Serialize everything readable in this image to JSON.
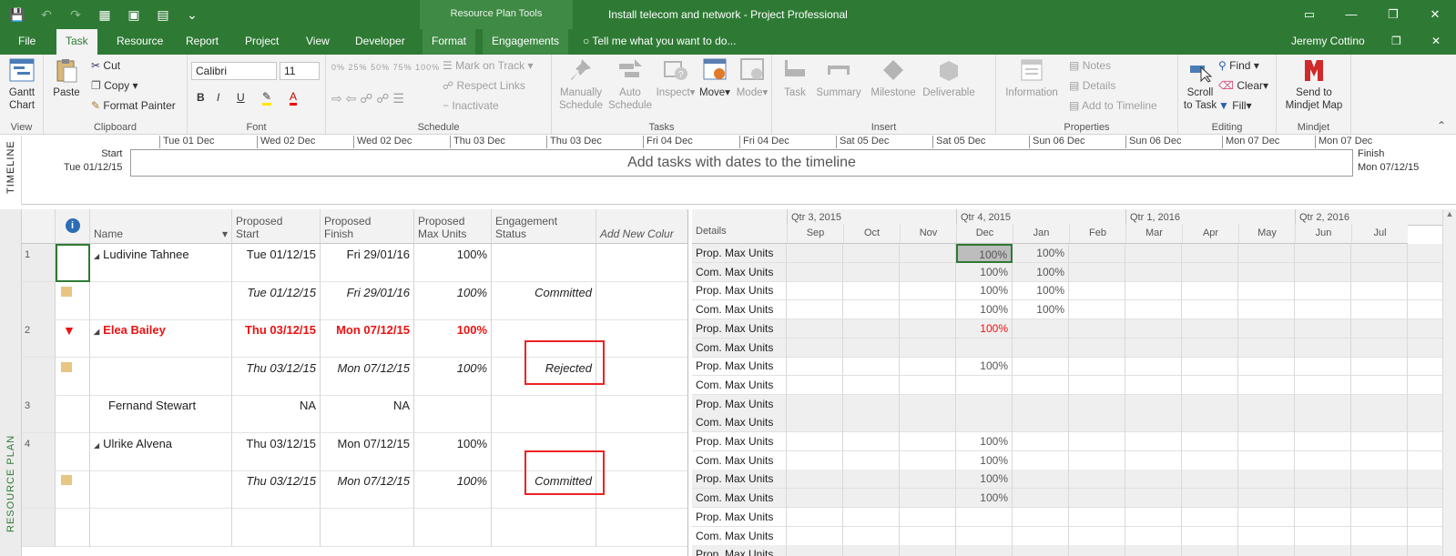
{
  "window": {
    "title": "Install telecom and network - Project Professional",
    "contextual_tab_group": "Resource Plan Tools",
    "user": "Jeremy Cottino"
  },
  "tabs": [
    {
      "label": "File"
    },
    {
      "label": "Task"
    },
    {
      "label": "Resource"
    },
    {
      "label": "Report"
    },
    {
      "label": "Project"
    },
    {
      "label": "View"
    },
    {
      "label": "Developer"
    },
    {
      "label": "Format"
    },
    {
      "label": "Engagements"
    }
  ],
  "tell_me": "Tell me what you want to do...",
  "ribbon": {
    "view": {
      "label": "View",
      "gantt": "Gantt\nChart"
    },
    "clipboard": {
      "label": "Clipboard",
      "paste": "Paste",
      "cut": "Cut",
      "copy": "Copy",
      "format_painter": "Format Painter"
    },
    "font": {
      "label": "Font",
      "family": "Calibri",
      "size": "11",
      "bold": "B",
      "italic": "I",
      "underline": "U"
    },
    "schedule": {
      "label": "Schedule",
      "mark_on_track": "Mark on Track",
      "respect_links": "Respect Links",
      "inactivate": "Inactivate",
      "pct": [
        "0%",
        "25%",
        "50%",
        "75%",
        "100%"
      ]
    },
    "tasks": {
      "label": "Tasks",
      "manually": "Manually\nSchedule",
      "auto": "Auto\nSchedule",
      "inspect": "Inspect",
      "move": "Move",
      "mode": "Mode"
    },
    "insert": {
      "label": "Insert",
      "task": "Task",
      "summary": "Summary",
      "milestone": "Milestone",
      "deliverable": "Deliverable"
    },
    "properties": {
      "label": "Properties",
      "information": "Information",
      "notes": "Notes",
      "details": "Details",
      "add_to_timeline": "Add to Timeline"
    },
    "editing": {
      "label": "Editing",
      "scroll": "Scroll\nto Task",
      "find": "Find",
      "clear": "Clear",
      "fill": "Fill"
    },
    "mindjet": {
      "label": "Mindjet",
      "send": "Send to\nMindjet Map"
    }
  },
  "timeline": {
    "side_label": "TIMELINE",
    "start_label": "Start",
    "start_date": "Tue 01/12/15",
    "finish_label": "Finish",
    "finish_date": "Mon 07/12/15",
    "placeholder": "Add tasks with dates to the timeline",
    "ticks": [
      "Tue 01 Dec",
      "Wed 02 Dec",
      "Wed 02 Dec",
      "Thu 03 Dec",
      "Thu 03 Dec",
      "Fri 04 Dec",
      "Fri 04 Dec",
      "Sat 05 Dec",
      "Sat 05 Dec",
      "Sun 06 Dec",
      "Sun 06 Dec",
      "Mon 07 Dec",
      "Mon 07 Dec"
    ]
  },
  "resource_plan_label": "RESOURCE PLAN",
  "sheet": {
    "headers": {
      "name": "Name",
      "start": "Proposed\nStart",
      "finish": "Proposed\nFinish",
      "max_units": "Proposed\nMax Units",
      "status": "Engagement\nStatus",
      "add_new": "Add New Colur"
    },
    "rows": [
      {
        "id": "1",
        "name": "Ludivine Tahnee",
        "start": "Tue 01/12/15",
        "finish": "Fri 29/01/16",
        "units": "100%",
        "status": "",
        "style": "summary"
      },
      {
        "id": "",
        "name": "",
        "start": "Tue 01/12/15",
        "finish": "Fri 29/01/16",
        "units": "100%",
        "status": "Committed",
        "style": "engagement"
      },
      {
        "id": "2",
        "name": "Elea Bailey",
        "start": "Thu 03/12/15",
        "finish": "Mon 07/12/15",
        "units": "100%",
        "status": "",
        "style": "overallocated"
      },
      {
        "id": "",
        "name": "",
        "start": "Thu 03/12/15",
        "finish": "Mon 07/12/15",
        "units": "100%",
        "status": "Rejected",
        "style": "engagement"
      },
      {
        "id": "3",
        "name": "Fernand Stewart",
        "start": "NA",
        "finish": "NA",
        "units": "",
        "status": "",
        "style": "plain"
      },
      {
        "id": "4",
        "name": "Ulrike Alvena",
        "start": "Thu 03/12/15",
        "finish": "Mon 07/12/15",
        "units": "100%",
        "status": "",
        "style": "summary"
      },
      {
        "id": "",
        "name": "",
        "start": "Thu 03/12/15",
        "finish": "Mon 07/12/15",
        "units": "100%",
        "status": "Committed",
        "style": "engagement"
      },
      {
        "id": "",
        "name": "",
        "start": "",
        "finish": "",
        "units": "",
        "status": "",
        "style": "plain"
      }
    ]
  },
  "usage": {
    "details_header": "Details",
    "quarters": [
      "Qtr 3, 2015",
      "Qtr 4, 2015",
      "Qtr 1, 2016",
      "Qtr 2, 2016"
    ],
    "months": [
      "Sep",
      "Oct",
      "Nov",
      "Dec",
      "Jan",
      "Feb",
      "Mar",
      "Apr",
      "May",
      "Jun",
      "Jul"
    ],
    "prop_label": "Prop. Max Units",
    "com_label": "Com. Max Units",
    "rows": [
      {
        "dec": "100%",
        "jan": "100%"
      },
      {
        "dec": "100%",
        "jan": "100%"
      },
      {
        "dec": "100%",
        "jan": "100%"
      },
      {
        "dec": "100%",
        "jan": "100%"
      },
      {
        "dec": "100%",
        "jan": "",
        "red": true
      },
      {
        "dec": "",
        "jan": ""
      },
      {
        "dec": "100%",
        "jan": ""
      },
      {
        "dec": "",
        "jan": ""
      },
      {
        "dec": "",
        "jan": ""
      },
      {
        "dec": "",
        "jan": ""
      },
      {
        "dec": "100%",
        "jan": ""
      },
      {
        "dec": "100%",
        "jan": ""
      },
      {
        "dec": "100%",
        "jan": ""
      },
      {
        "dec": "100%",
        "jan": ""
      },
      {
        "dec": "",
        "jan": ""
      },
      {
        "dec": "",
        "jan": ""
      },
      {
        "dec": "",
        "jan": ""
      }
    ]
  },
  "colors": {
    "accent": "#2e7a34",
    "overallocated": "#e11111",
    "highlight_box": "#e22222"
  }
}
